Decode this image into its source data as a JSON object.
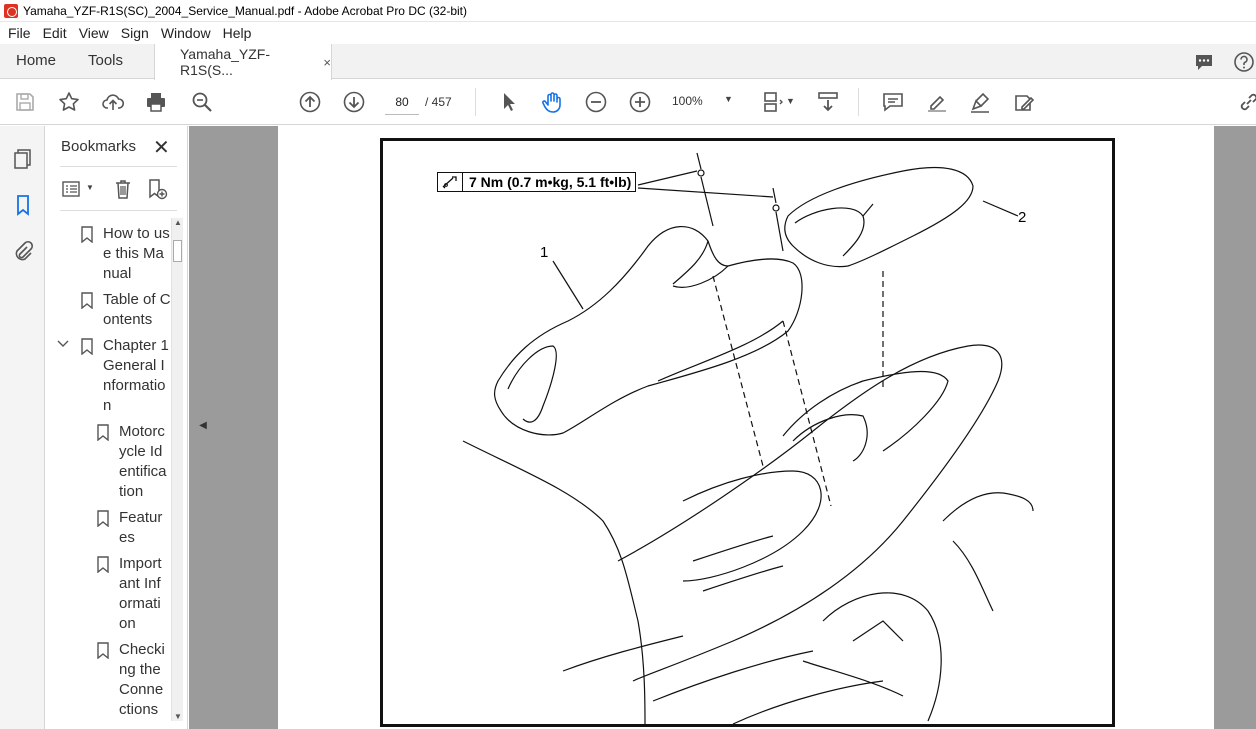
{
  "window": {
    "title": "Yamaha_YZF-R1S(SC)_2004_Service_Manual.pdf - Adobe Acrobat Pro DC (32-bit)"
  },
  "menu": [
    "File",
    "Edit",
    "View",
    "Sign",
    "Window",
    "Help"
  ],
  "tabs": {
    "home": "Home",
    "tools": "Tools",
    "document": "Yamaha_YZF-R1S(S...",
    "close_glyph": "×"
  },
  "toolbar": {
    "page_current": "80",
    "page_total": "/ 457",
    "zoom": "100%",
    "icons": [
      "save-icon",
      "star-icon",
      "upload-icon",
      "print-icon",
      "zoom-search-icon",
      "prev-page-icon",
      "next-page-icon",
      "select-arrow-icon",
      "hand-icon",
      "zoom-out-icon",
      "zoom-in-icon",
      "page-fit-icon",
      "scroll-mode-icon",
      "comment-icon",
      "highlight-icon",
      "sign-icon",
      "fill-sign-icon",
      "link-icon"
    ]
  },
  "bookmarks": {
    "title": "Bookmarks",
    "close_glyph": "✕",
    "items": [
      {
        "label": "How to use this Manual",
        "level": 0
      },
      {
        "label": "Table of Contents",
        "level": 0
      },
      {
        "label": "Chapter 1 General Information",
        "level": 0,
        "expanded": true
      },
      {
        "label": "Motorcycle Identification",
        "level": 1
      },
      {
        "label": "Features",
        "level": 1
      },
      {
        "label": "Important Information",
        "level": 1
      },
      {
        "label": "Checking the Connections",
        "level": 1
      }
    ]
  },
  "document": {
    "torque_spec": "7 Nm (0.7 m•kg, 5.1 ft•lb)",
    "callout_1": "1",
    "callout_2": "2"
  },
  "colors": {
    "accent_blue": "#1473e6",
    "icon_gray": "#555555",
    "app_red": "#dd3322",
    "doc_background": "#9b9b9b"
  }
}
